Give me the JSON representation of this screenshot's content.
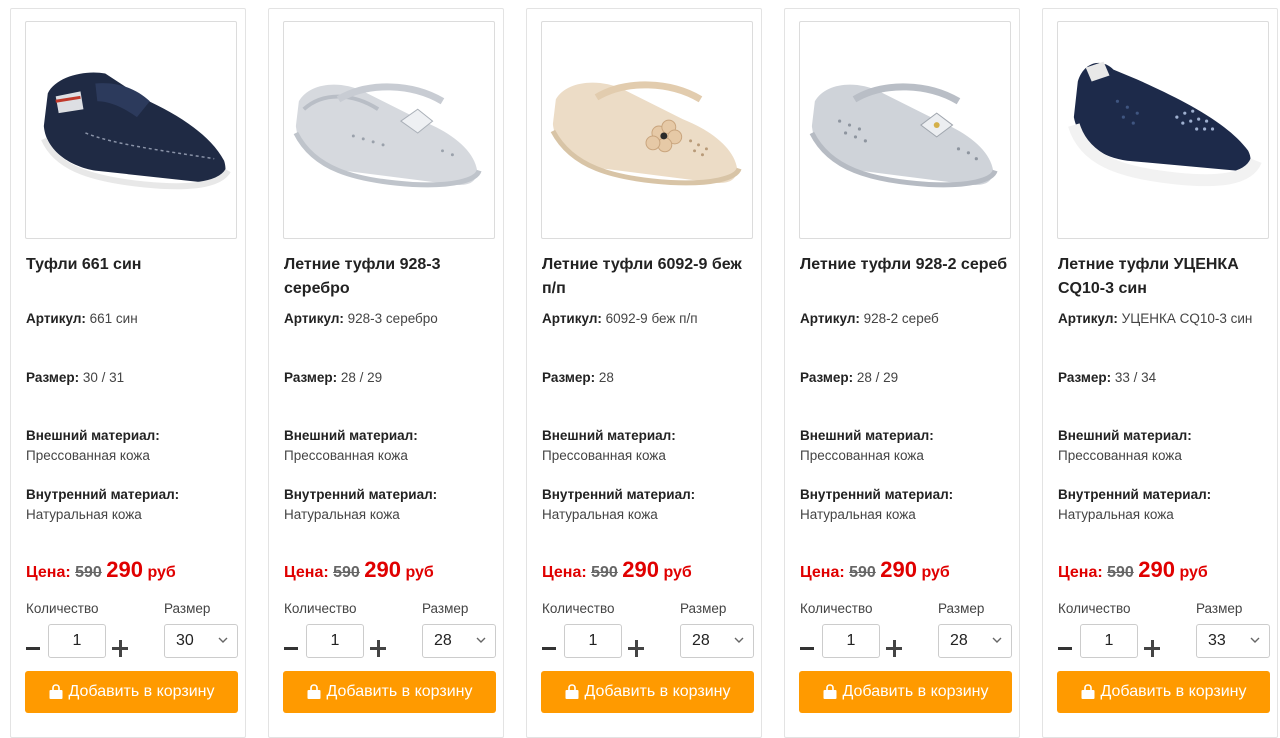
{
  "labels": {
    "article": "Артикул:",
    "size": "Размер:",
    "outer_material": "Внешний материал:",
    "inner_material": "Внутренний материал:",
    "price": "Цена:",
    "currency": "руб",
    "quantity": "Количество",
    "size_select": "Размер",
    "add_to_cart": "Добавить в корзину"
  },
  "colors": {
    "price_red": "#e00000",
    "cart_orange": "#ff9a00"
  },
  "products": [
    {
      "title": "Туфли 661 син",
      "article": "661 син",
      "size": "30 / 31",
      "outer_material": "Прессованная кожа",
      "inner_material": "Натуральная кожа",
      "old_price": "590",
      "price": "290",
      "quantity": "1",
      "selected_size": "30",
      "image": "navy-loafer-shoe"
    },
    {
      "title": "Летние туфли 928-3 серебро",
      "article": "928-3 серебро",
      "size": "28 / 29",
      "outer_material": "Прессованная кожа",
      "inner_material": "Натуральная кожа",
      "old_price": "590",
      "price": "290",
      "quantity": "1",
      "selected_size": "28",
      "image": "silver-mary-jane-shoe"
    },
    {
      "title": "Летние туфли 6092-9 беж п/п",
      "article": "6092-9 беж п/п",
      "size": "28",
      "outer_material": "Прессованная кожа",
      "inner_material": "Натуральная кожа",
      "old_price": "590",
      "price": "290",
      "quantity": "1",
      "selected_size": "28",
      "image": "beige-mary-jane-shoe"
    },
    {
      "title": "Летние туфли 928-2 сереб",
      "article": "928-2 сереб",
      "size": "28 / 29",
      "outer_material": "Прессованная кожа",
      "inner_material": "Натуральная кожа",
      "old_price": "590",
      "price": "290",
      "quantity": "1",
      "selected_size": "28",
      "image": "silver-perforated-shoe"
    },
    {
      "title": "Летние туфли УЦЕНКА CQ10-3 син",
      "article": "УЦЕНКА CQ10-3 син",
      "size": "33 / 34",
      "outer_material": "Прессованная кожа",
      "inner_material": "Натуральная кожа",
      "old_price": "590",
      "price": "290",
      "quantity": "1",
      "selected_size": "33",
      "image": "navy-slip-on-shoe"
    }
  ]
}
